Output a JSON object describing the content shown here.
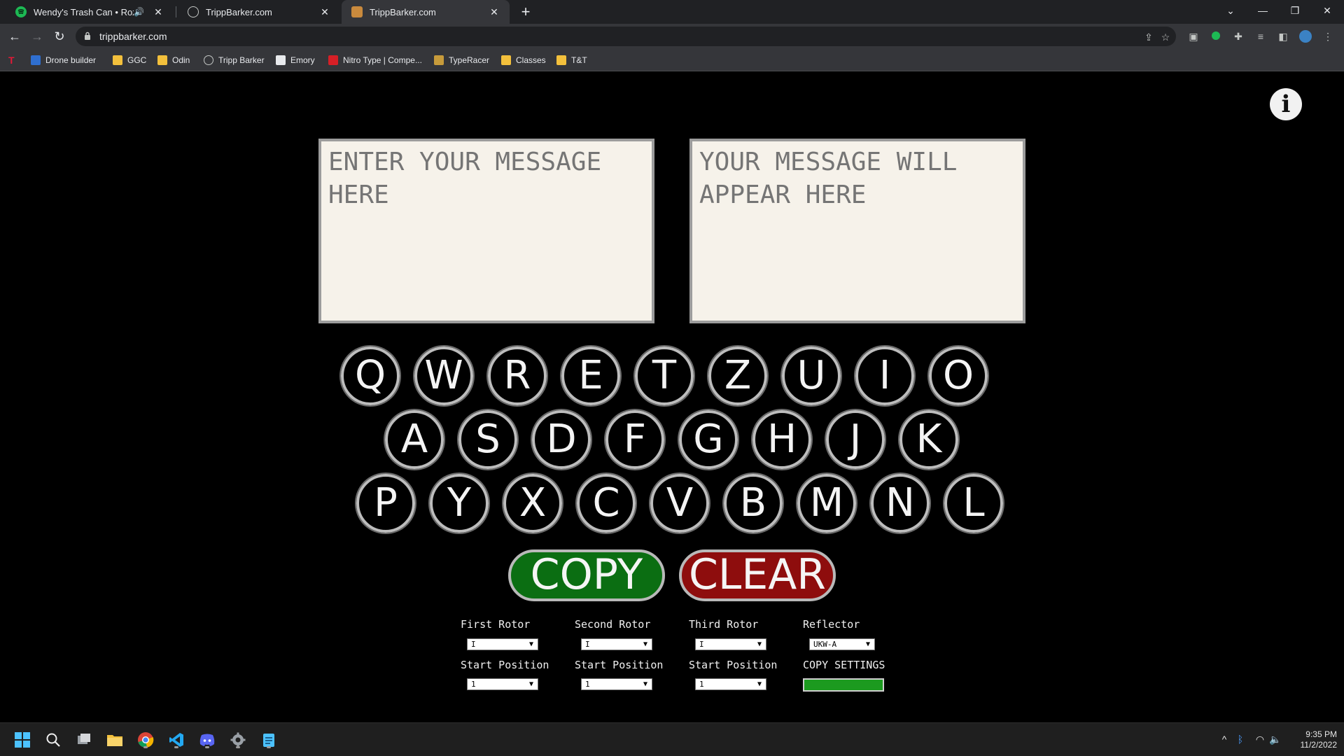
{
  "browser": {
    "tabs": [
      {
        "title": "Wendy's Trash Can • Rozwell",
        "favicon": "spotify-icon",
        "audio": true
      },
      {
        "title": "TrippBarker.com",
        "favicon": "globe-icon"
      },
      {
        "title": "TrippBarker.com",
        "favicon": "site-icon",
        "active": true
      }
    ],
    "url": "trippbarker.com",
    "bookmarks": [
      {
        "label": "Drone builder",
        "icon": "drone-icon"
      },
      {
        "label": "GGC",
        "icon": "folder-icon"
      },
      {
        "label": "Odin",
        "icon": "folder-icon"
      },
      {
        "label": "Tripp Barker",
        "icon": "globe-icon"
      },
      {
        "label": "Emory",
        "icon": "emory-icon"
      },
      {
        "label": "Nitro Type | Compe...",
        "icon": "nitro-icon"
      },
      {
        "label": "TypeRacer",
        "icon": "typeracer-icon"
      },
      {
        "label": "Classes",
        "icon": "folder-icon"
      },
      {
        "label": "T&T",
        "icon": "folder-icon"
      }
    ]
  },
  "app": {
    "info_label": "i",
    "input_placeholder": "ENTER YOUR MESSAGE HERE",
    "output_placeholder": "YOUR MESSAGE WILL APPEAR HERE",
    "keyboard": {
      "row1": [
        "Q",
        "W",
        "R",
        "E",
        "T",
        "Z",
        "U",
        "I",
        "O"
      ],
      "row2": [
        "A",
        "S",
        "D",
        "F",
        "G",
        "H",
        "J",
        "K"
      ],
      "row3": [
        "P",
        "Y",
        "X",
        "C",
        "V",
        "B",
        "M",
        "N",
        "L"
      ]
    },
    "copy_label": "COPY",
    "clear_label": "CLEAR",
    "settings": {
      "first_rotor_label": "First Rotor",
      "second_rotor_label": "Second Rotor",
      "third_rotor_label": "Third Rotor",
      "reflector_label": "Reflector",
      "start_position_label": "Start Position",
      "copy_settings_label": "COPY SETTINGS",
      "first_rotor_value": "I",
      "second_rotor_value": "I",
      "third_rotor_value": "I",
      "reflector_value": "UKW-A",
      "first_start_value": "1",
      "second_start_value": "1",
      "third_start_value": "1"
    },
    "colors": {
      "copy": "#0b6e12",
      "clear": "#8e0d0d",
      "copy_settings": "#1c9a1f"
    }
  },
  "taskbar": {
    "time": "9:35 PM",
    "date": "11/2/2022",
    "apps": [
      "windows-start-icon",
      "search-icon",
      "task-view-icon",
      "file-explorer-icon",
      "chrome-icon",
      "vscode-icon",
      "discord-icon",
      "settings-icon",
      "notepad-icon"
    ]
  }
}
